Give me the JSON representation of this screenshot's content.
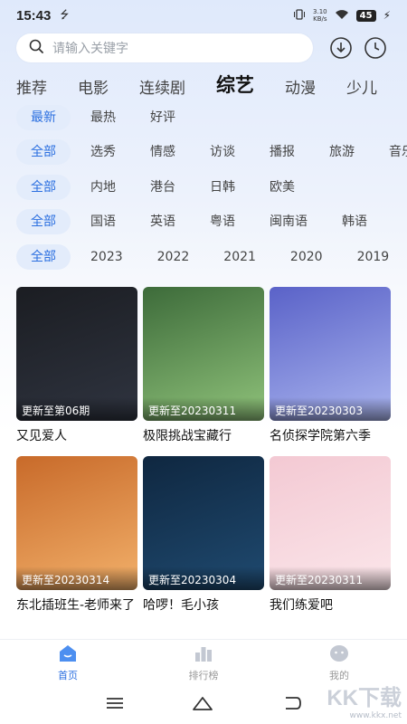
{
  "status": {
    "time": "15:43",
    "net_speed_value": "3.10",
    "net_speed_unit": "KB/s",
    "battery": "45"
  },
  "search": {
    "placeholder": "请输入关键字"
  },
  "tabs": [
    {
      "label": "推荐",
      "active": false
    },
    {
      "label": "电影",
      "active": false
    },
    {
      "label": "连续剧",
      "active": false
    },
    {
      "label": "综艺",
      "active": true
    },
    {
      "label": "动漫",
      "active": false
    },
    {
      "label": "少儿",
      "active": false
    }
  ],
  "filters": {
    "sort": [
      "最新",
      "最热",
      "好评"
    ],
    "genre": [
      "全部",
      "选秀",
      "情感",
      "访谈",
      "播报",
      "旅游",
      "音乐"
    ],
    "region": [
      "全部",
      "内地",
      "港台",
      "日韩",
      "欧美"
    ],
    "language": [
      "全部",
      "国语",
      "英语",
      "粤语",
      "闽南语",
      "韩语"
    ],
    "year": [
      "全部",
      "2023",
      "2022",
      "2021",
      "2020",
      "2019"
    ]
  },
  "cards": [
    {
      "title": "又见爱人",
      "update": "更新至第06期",
      "colors": [
        "#1b1d22",
        "#2f3440"
      ]
    },
    {
      "title": "极限挑战宝藏行",
      "update": "更新至20230311",
      "colors": [
        "#3d6b3a",
        "#8fc27a"
      ]
    },
    {
      "title": "名侦探学院第六季",
      "update": "更新至20230303",
      "colors": [
        "#5a62c8",
        "#a9b4ee"
      ]
    },
    {
      "title": "东北插班生-老师来了",
      "update": "更新至20230314",
      "colors": [
        "#c86a2a",
        "#f2b06a"
      ]
    },
    {
      "title": "哈啰！毛小孩",
      "update": "更新至20230304",
      "colors": [
        "#0f2740",
        "#1f4a70"
      ]
    },
    {
      "title": "我们练爱吧",
      "update": "更新至20230311",
      "colors": [
        "#f3c9d3",
        "#fbe6ea"
      ]
    }
  ],
  "nav": [
    {
      "label": "首页",
      "active": true
    },
    {
      "label": "排行榜",
      "active": false
    },
    {
      "label": "我的",
      "active": false
    }
  ],
  "watermark": {
    "logo": "KK下载",
    "url": "www.kkx.net"
  },
  "accent": "#2b6fe0"
}
